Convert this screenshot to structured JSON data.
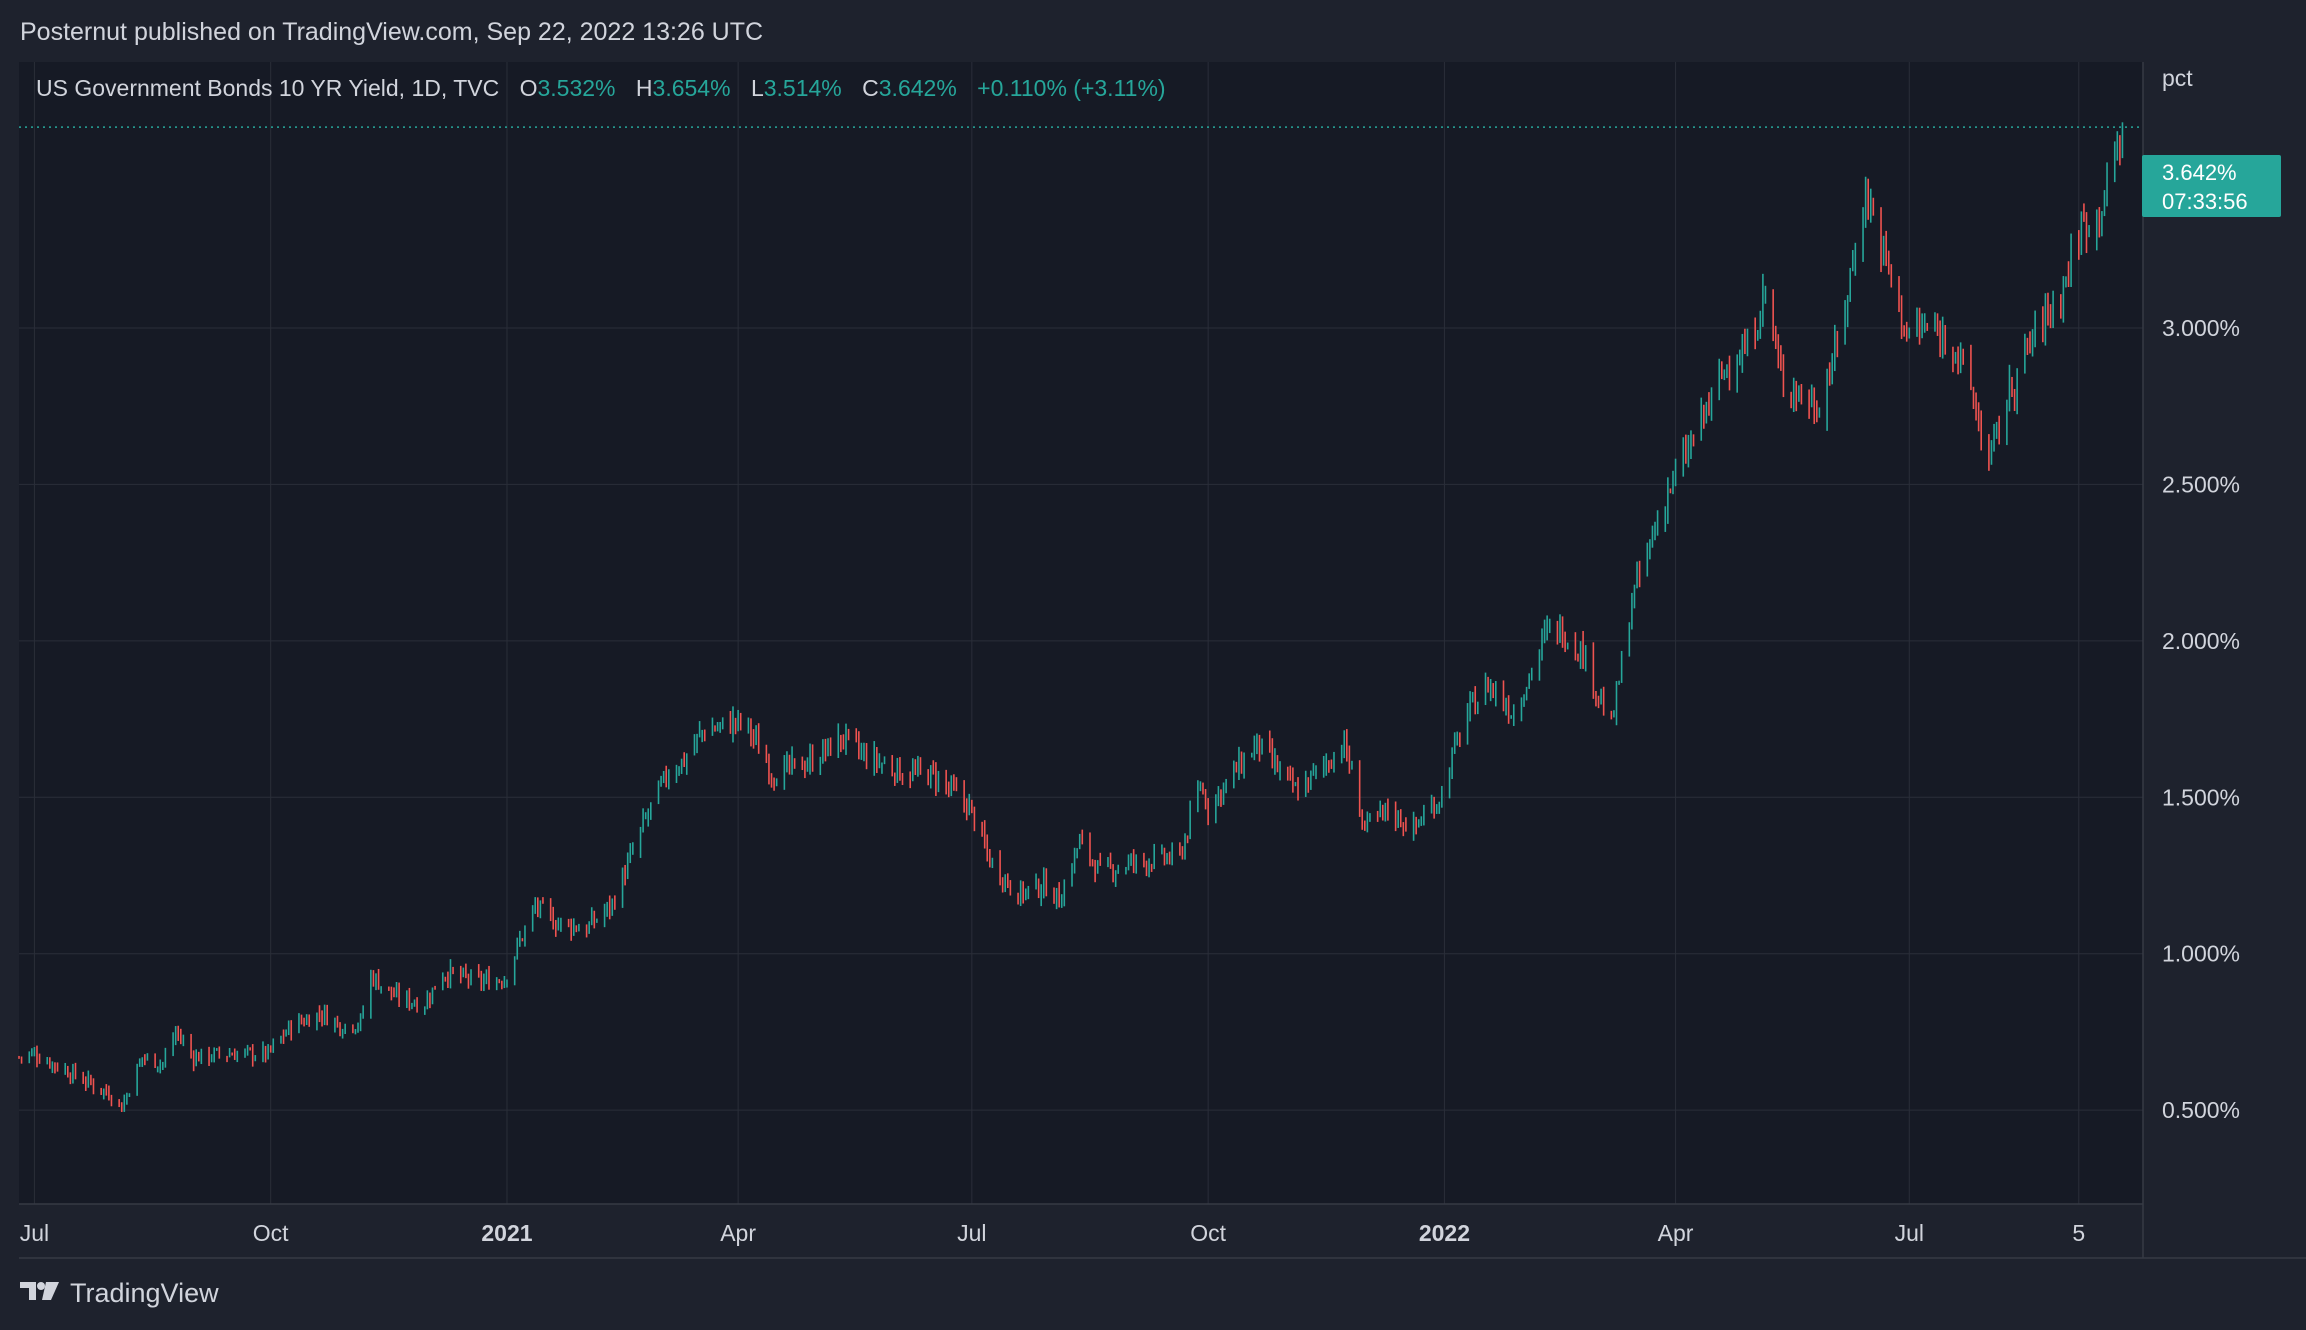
{
  "header": {
    "publisher": "Posternut published on TradingView.com, Sep 22, 2022 13:26 UTC"
  },
  "legend": {
    "symbol": "US Government Bonds 10 YR Yield, 1D, TVC",
    "open_label": "O",
    "open_value": "3.532%",
    "high_label": "H",
    "high_value": "3.654%",
    "low_label": "L",
    "low_value": "3.514%",
    "close_label": "C",
    "close_value": "3.642%",
    "change": "+0.110% (+3.11%)"
  },
  "axis": {
    "unit": "pct"
  },
  "last_price": {
    "value": "3.642%",
    "countdown": "07:33:56"
  },
  "footer": {
    "brand": "TradingView"
  },
  "colors": {
    "up": "#26a69a",
    "down": "#ef5350",
    "background": "#1e222d",
    "plot_background": "#161a25",
    "grid": "#2a2e39",
    "text": "#d1d4dc"
  },
  "chart_data": {
    "type": "candlestick",
    "title": "US Government Bonds 10 YR Yield, 1D, TVC",
    "ylabel": "pct",
    "ylim": [
      0.2,
      3.85
    ],
    "y_ticks": [
      "0.500%",
      "1.000%",
      "1.500%",
      "2.000%",
      "2.500%",
      "3.000%"
    ],
    "x_ticks": [
      {
        "label": "Jul",
        "date": "2020-07-01",
        "bold": false
      },
      {
        "label": "Oct",
        "date": "2020-10-01",
        "bold": false
      },
      {
        "label": "2021",
        "date": "2021-01-01",
        "bold": true
      },
      {
        "label": "Apr",
        "date": "2021-04-01",
        "bold": false
      },
      {
        "label": "Jul",
        "date": "2021-07-01",
        "bold": false
      },
      {
        "label": "Oct",
        "date": "2021-10-01",
        "bold": false
      },
      {
        "label": "2022",
        "date": "2022-01-01",
        "bold": true
      },
      {
        "label": "Apr",
        "date": "2022-04-01",
        "bold": false
      },
      {
        "label": "Jul",
        "date": "2022-07-01",
        "bold": false
      },
      {
        "label": "5",
        "date": "2022-09-05",
        "bold": false
      }
    ],
    "xlim": [
      "2020-06-25",
      "2022-09-30"
    ],
    "last_close": 3.642,
    "path": [
      [
        "2020-06-25",
        0.67
      ],
      [
        "2020-07-01",
        0.68
      ],
      [
        "2020-07-15",
        0.62
      ],
      [
        "2020-07-31",
        0.55
      ],
      [
        "2020-08-04",
        0.51
      ],
      [
        "2020-08-12",
        0.67
      ],
      [
        "2020-08-20",
        0.65
      ],
      [
        "2020-08-25",
        0.75
      ],
      [
        "2020-09-01",
        0.67
      ],
      [
        "2020-09-15",
        0.68
      ],
      [
        "2020-09-30",
        0.68
      ],
      [
        "2020-10-01",
        0.69
      ],
      [
        "2020-10-09",
        0.77
      ],
      [
        "2020-10-21",
        0.81
      ],
      [
        "2020-10-28",
        0.77
      ],
      [
        "2020-11-05",
        0.78
      ],
      [
        "2020-11-09",
        0.93
      ],
      [
        "2020-11-19",
        0.86
      ],
      [
        "2020-11-30",
        0.84
      ],
      [
        "2020-12-07",
        0.94
      ],
      [
        "2020-12-21",
        0.91
      ],
      [
        "2020-12-31",
        0.92
      ],
      [
        "2021-01-06",
        1.04
      ],
      [
        "2021-01-12",
        1.15
      ],
      [
        "2021-01-20",
        1.1
      ],
      [
        "2021-02-01",
        1.08
      ],
      [
        "2021-02-11",
        1.16
      ],
      [
        "2021-02-25",
        1.45
      ],
      [
        "2021-03-05",
        1.58
      ],
      [
        "2021-03-11",
        1.62
      ],
      [
        "2021-03-18",
        1.71
      ],
      [
        "2021-03-31",
        1.74
      ],
      [
        "2021-04-05",
        1.72
      ],
      [
        "2021-04-15",
        1.57
      ],
      [
        "2021-04-30",
        1.62
      ],
      [
        "2021-05-12",
        1.69
      ],
      [
        "2021-05-20",
        1.63
      ],
      [
        "2021-06-04",
        1.58
      ],
      [
        "2021-06-16",
        1.57
      ],
      [
        "2021-06-30",
        1.47
      ],
      [
        "2021-07-08",
        1.3
      ],
      [
        "2021-07-19",
        1.19
      ],
      [
        "2021-07-30",
        1.22
      ],
      [
        "2021-08-04",
        1.17
      ],
      [
        "2021-08-12",
        1.36
      ],
      [
        "2021-08-20",
        1.26
      ],
      [
        "2021-09-01",
        1.29
      ],
      [
        "2021-09-20",
        1.31
      ],
      [
        "2021-09-28",
        1.54
      ],
      [
        "2021-10-01",
        1.47
      ],
      [
        "2021-10-20",
        1.67
      ],
      [
        "2021-10-26",
        1.61
      ],
      [
        "2021-11-04",
        1.52
      ],
      [
        "2021-11-10",
        1.56
      ],
      [
        "2021-11-23",
        1.67
      ],
      [
        "2021-12-01",
        1.4
      ],
      [
        "2021-12-10",
        1.46
      ],
      [
        "2021-12-20",
        1.4
      ],
      [
        "2021-12-31",
        1.51
      ],
      [
        "2022-01-04",
        1.63
      ],
      [
        "2022-01-10",
        1.77
      ],
      [
        "2022-01-18",
        1.86
      ],
      [
        "2022-01-28",
        1.77
      ],
      [
        "2022-02-10",
        2.03
      ],
      [
        "2022-02-15",
        2.04
      ],
      [
        "2022-02-24",
        1.96
      ],
      [
        "2022-03-07",
        1.72
      ],
      [
        "2022-03-15",
        2.13
      ],
      [
        "2022-03-28",
        2.46
      ],
      [
        "2022-04-06",
        2.61
      ],
      [
        "2022-04-12",
        2.72
      ],
      [
        "2022-04-22",
        2.9
      ],
      [
        "2022-04-29",
        2.93
      ],
      [
        "2022-05-06",
        3.12
      ],
      [
        "2022-05-12",
        2.84
      ],
      [
        "2022-05-26",
        2.75
      ],
      [
        "2022-06-03",
        2.94
      ],
      [
        "2022-06-14",
        3.44
      ],
      [
        "2022-06-20",
        3.27
      ],
      [
        "2022-06-30",
        2.98
      ],
      [
        "2022-07-07",
        3.0
      ],
      [
        "2022-07-18",
        2.96
      ],
      [
        "2022-07-25",
        2.8
      ],
      [
        "2022-08-01",
        2.57
      ],
      [
        "2022-08-08",
        2.77
      ],
      [
        "2022-08-19",
        2.99
      ],
      [
        "2022-08-29",
        3.11
      ],
      [
        "2022-09-06",
        3.33
      ],
      [
        "2022-09-12",
        3.36
      ],
      [
        "2022-09-16",
        3.45
      ],
      [
        "2022-09-22",
        3.64
      ]
    ]
  }
}
